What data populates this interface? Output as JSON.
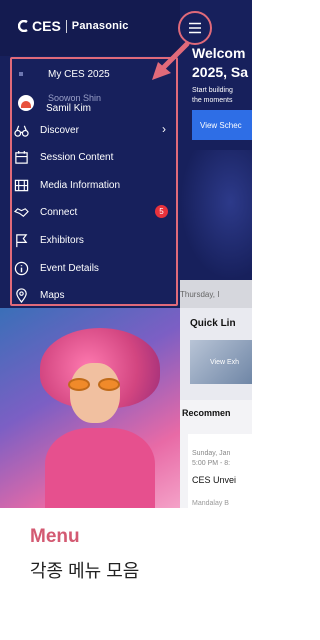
{
  "sidebar": {
    "brand_ces": "CES",
    "brand_panasonic": "Panasonic",
    "my_ces": "My CES 2025",
    "profile_ghost": "Soowon Shin",
    "profile_name": "Samil Kim",
    "items": [
      {
        "label": "Discover",
        "icon": "binoculars-icon",
        "chevron": "›"
      },
      {
        "label": "Session Content",
        "icon": "calendar-icon"
      },
      {
        "label": "Media Information",
        "icon": "film-icon"
      },
      {
        "label": "Connect",
        "icon": "handshake-icon",
        "badge": "5"
      },
      {
        "label": "Exhibitors",
        "icon": "flag-icon"
      },
      {
        "label": "Event Details",
        "icon": "info-icon"
      },
      {
        "label": "Maps",
        "icon": "map-pin-icon"
      }
    ]
  },
  "main": {
    "welcome_line1": "Welcom",
    "welcome_line2": "2025, Sa",
    "subtitle_line1": "Start building",
    "subtitle_line2": "the moments",
    "view_button": "View Schec",
    "date": "Thursday, I",
    "quick_links": "Quick Lin",
    "quick_card": "View Exh",
    "recommended": "Recommen",
    "card_date": "Sunday, Jan",
    "card_time": "5:00 PM - 8:",
    "card_title": "CES Unvei",
    "card_location": "Mandalay B"
  },
  "caption": {
    "title": "Menu",
    "subtitle": "각종 메뉴 모음"
  },
  "colors": {
    "sidebar_bg": "#17205c",
    "highlight": "#e06a7a",
    "badge": "#e8323c",
    "button": "#2e6ee6"
  }
}
